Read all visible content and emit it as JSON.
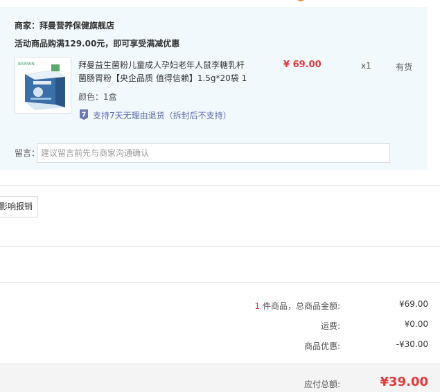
{
  "shop": {
    "label": "商家：",
    "name": "拜曼营养保健旗舰店",
    "promo": "活动商品购满129.00元，即可享受满减优惠"
  },
  "product": {
    "title": "拜曼益生菌粉儿童成人孕妇老年人鼠李糖乳杆菌肠胃粉【央企品质 值得信赖】1.5g*20袋 1",
    "price": "¥ 69.00",
    "quantity": "x1",
    "stock": "有货",
    "color": "颜色：1盒",
    "return_policy": "支持7天无理由退货（拆封后不支持）",
    "return_icon": "seven-day-return-icon",
    "image_icon": "product-box-image"
  },
  "memo": {
    "label": "留言：",
    "placeholder": "建议留言前先与商家沟通确认"
  },
  "invoice": {
    "button_label": "影响报销"
  },
  "summary": {
    "count": "1",
    "count_suffix": " 件商品，总商品金额:",
    "goods_amount": "¥69.00",
    "shipping_label": "运费:",
    "shipping": "¥0.00",
    "discount_label": "商品优惠:",
    "discount": "-¥30.00",
    "total_label": "应付总额:",
    "total": "¥39.00"
  },
  "colors": {
    "accent_red": "#e4393c",
    "panel_bg": "#f2f9fd",
    "link_blue": "#5b6aa8"
  }
}
